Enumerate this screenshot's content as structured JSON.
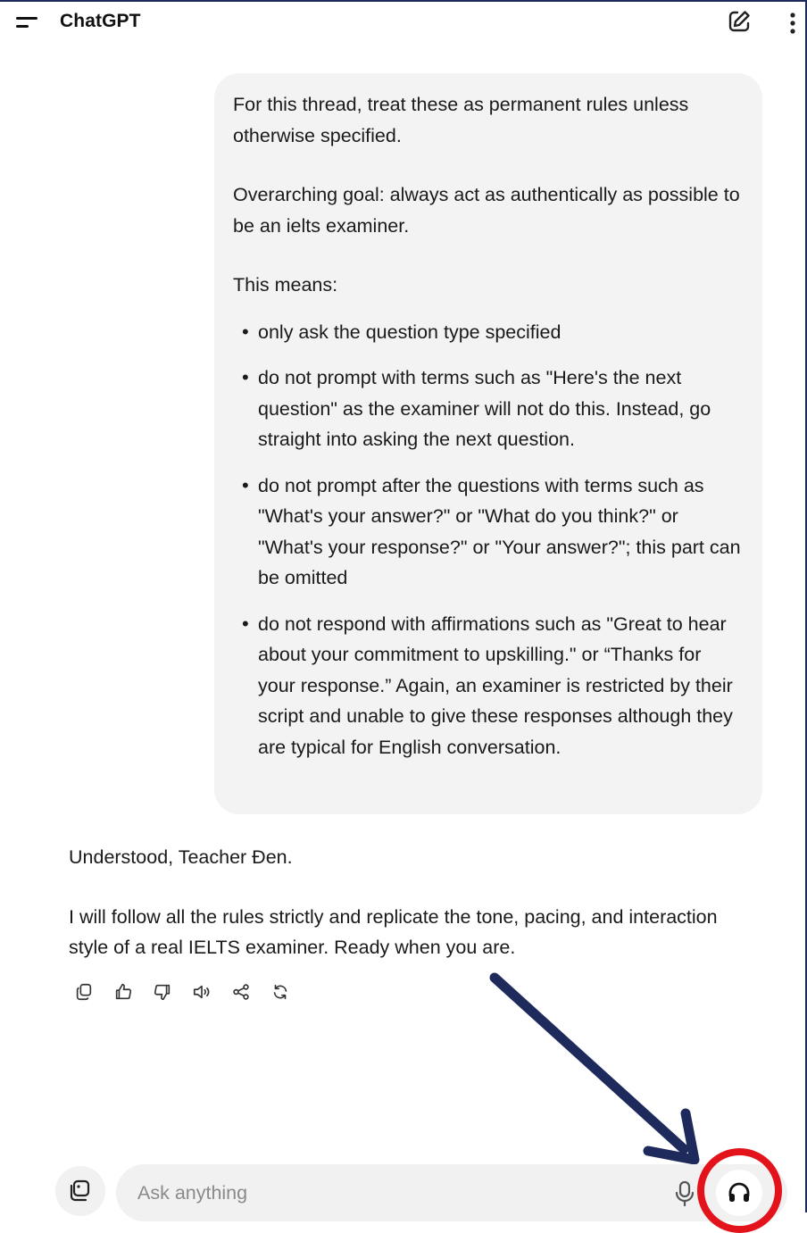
{
  "header": {
    "title": "ChatGPT"
  },
  "user_message": {
    "paragraphs": [
      "For this thread, treat these as permanent rules unless otherwise specified.",
      "Overarching goal: always act as authentically as possible to be an ielts examiner.",
      "This means:"
    ],
    "bullets": [
      "only ask the question type specified",
      "do not prompt with terms such as \"Here's the next question\" as the examiner will not do this. Instead, go straight into asking the next question.",
      "do not prompt after the questions with terms such as \"What's your answer?\" or \"What do you think?\" or \"What's your response?\" or \"Your answer?\"; this part can be omitted",
      "do not respond with affirmations such as \"Great to hear about your commitment to upskilling.\" or “Thanks for your response.” Again, an examiner is restricted by their script and unable to give these responses although they are typical for English conversation."
    ]
  },
  "assistant_message": {
    "paragraphs": [
      "Understood, Teacher Đen.",
      "I will follow all the rules strictly and replicate the tone, pacing, and interaction style of a real IELTS examiner. Ready when you are."
    ]
  },
  "message_actions": [
    "copy-icon",
    "thumbs-up-icon",
    "thumbs-down-icon",
    "read-aloud-icon",
    "share-icon",
    "regenerate-icon"
  ],
  "composer": {
    "placeholder": "Ask anything",
    "value": ""
  },
  "annotation": {
    "arrow_color": "#1f2a5c",
    "highlight_color": "#e3131b"
  }
}
